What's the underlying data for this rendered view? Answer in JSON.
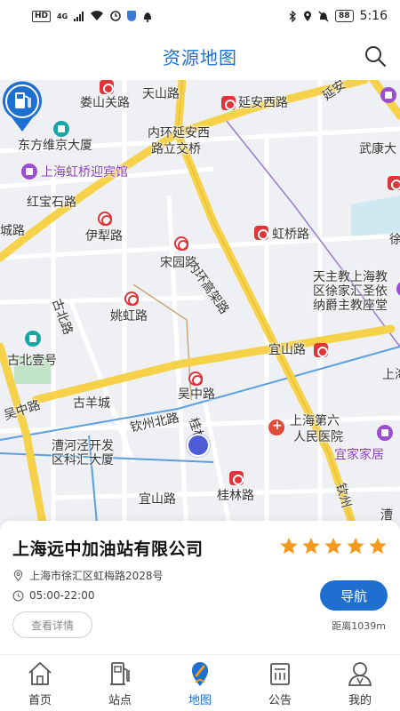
{
  "status_bar": {
    "hd": "HD",
    "network": "4G",
    "battery": "88",
    "time": "5:16"
  },
  "header": {
    "title": "资源地图"
  },
  "map": {
    "labels": {
      "loushanguan": "娄山关路",
      "tianshan": "天山路",
      "yanan_west": "延安西路",
      "yanan_e": "延安",
      "neihuan_1": "内环延安西",
      "neihuan_2": "路立交桥",
      "wukang": "武康大",
      "dongfang": "东方维京大厦",
      "hongqiao_hotel": "上海虹桥迎宾馆",
      "hongbaoshi": "红宝石路",
      "cheng": "城路",
      "hongqiao_rd": "虹桥路",
      "yili": "伊犁路",
      "songyuan": "宋园路",
      "neihuan_viaduct": "内环高架路",
      "xu": "徐",
      "tianzhu_1": "天主教上海教",
      "tianzhu_2": "区徐家汇圣依",
      "tianzhu_3": "纳爵主教座堂",
      "gubei": "古北路",
      "yaohong": "姚虹路",
      "gubei_no1": "古北壹号",
      "yishan_top": "宜山路",
      "shang": "上海",
      "wuzhong_left": "吴中路",
      "wuzhong_mid": "吴中路",
      "gu_cheng": "古羊城",
      "qinzhou": "钦州北路",
      "guilin_v": "桂林路",
      "sixth_1": "上海第六",
      "sixth_2": "人民医院",
      "yijia": "宜家家居",
      "caohejing_1": "漕河泾开发",
      "caohejing_2": "区科汇大厦",
      "yishan_bottom": "宜山路",
      "guilin_rd": "桂林路",
      "qin_right": "钦州",
      "cao_right": "漕"
    }
  },
  "station": {
    "name": "上海远中加油站有限公司",
    "rating": 5,
    "address": "上海市徐汇区虹梅路2028号",
    "hours": "05:00-22:00",
    "detail_label": "查看详情",
    "nav_label": "导航",
    "distance": "距离1039m"
  },
  "colors": {
    "accent": "#1f6fd1",
    "star": "#f39a1e",
    "road_major": "#f5d24a",
    "road_minor": "#ffffff",
    "metro": "#e0343b"
  },
  "tabs": [
    {
      "label": "首页",
      "icon": "home-icon"
    },
    {
      "label": "站点",
      "icon": "fuel-station-icon"
    },
    {
      "label": "地图",
      "icon": "map-pin-icon",
      "active": true
    },
    {
      "label": "公告",
      "icon": "notice-board-icon"
    },
    {
      "label": "我的",
      "icon": "user-icon"
    }
  ]
}
